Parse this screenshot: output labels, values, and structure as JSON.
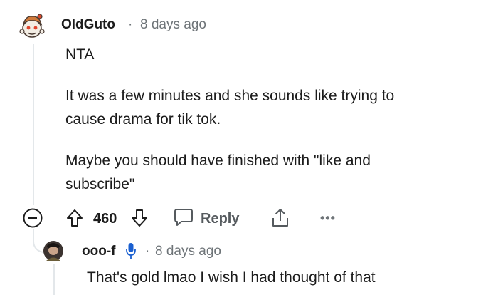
{
  "comment": {
    "username": "OldGuto",
    "separator": "·",
    "timestamp": "8 days ago",
    "paragraphs": [
      "NTA",
      "It was a few minutes and she sounds like trying to",
      "cause drama for tik tok.",
      "Maybe you should have finished with \"like and",
      "subscribe\""
    ],
    "score": "460",
    "reply_label": "Reply",
    "more_label": "•••"
  },
  "reply": {
    "username": "ooo-f",
    "separator": "·",
    "timestamp": "8 days ago",
    "text": "That's gold lmao I wish I had thought of that"
  },
  "colors": {
    "text": "#1c1c1c",
    "meta": "#6e7478",
    "thread": "#e3e7ea",
    "mic": "#1a5fd0"
  },
  "icons": [
    "avatar-snoo-icon",
    "collapse-icon",
    "upvote-icon",
    "downvote-icon",
    "comment-bubble-icon",
    "share-icon",
    "more-icon",
    "microphone-icon",
    "avatar-icon"
  ]
}
